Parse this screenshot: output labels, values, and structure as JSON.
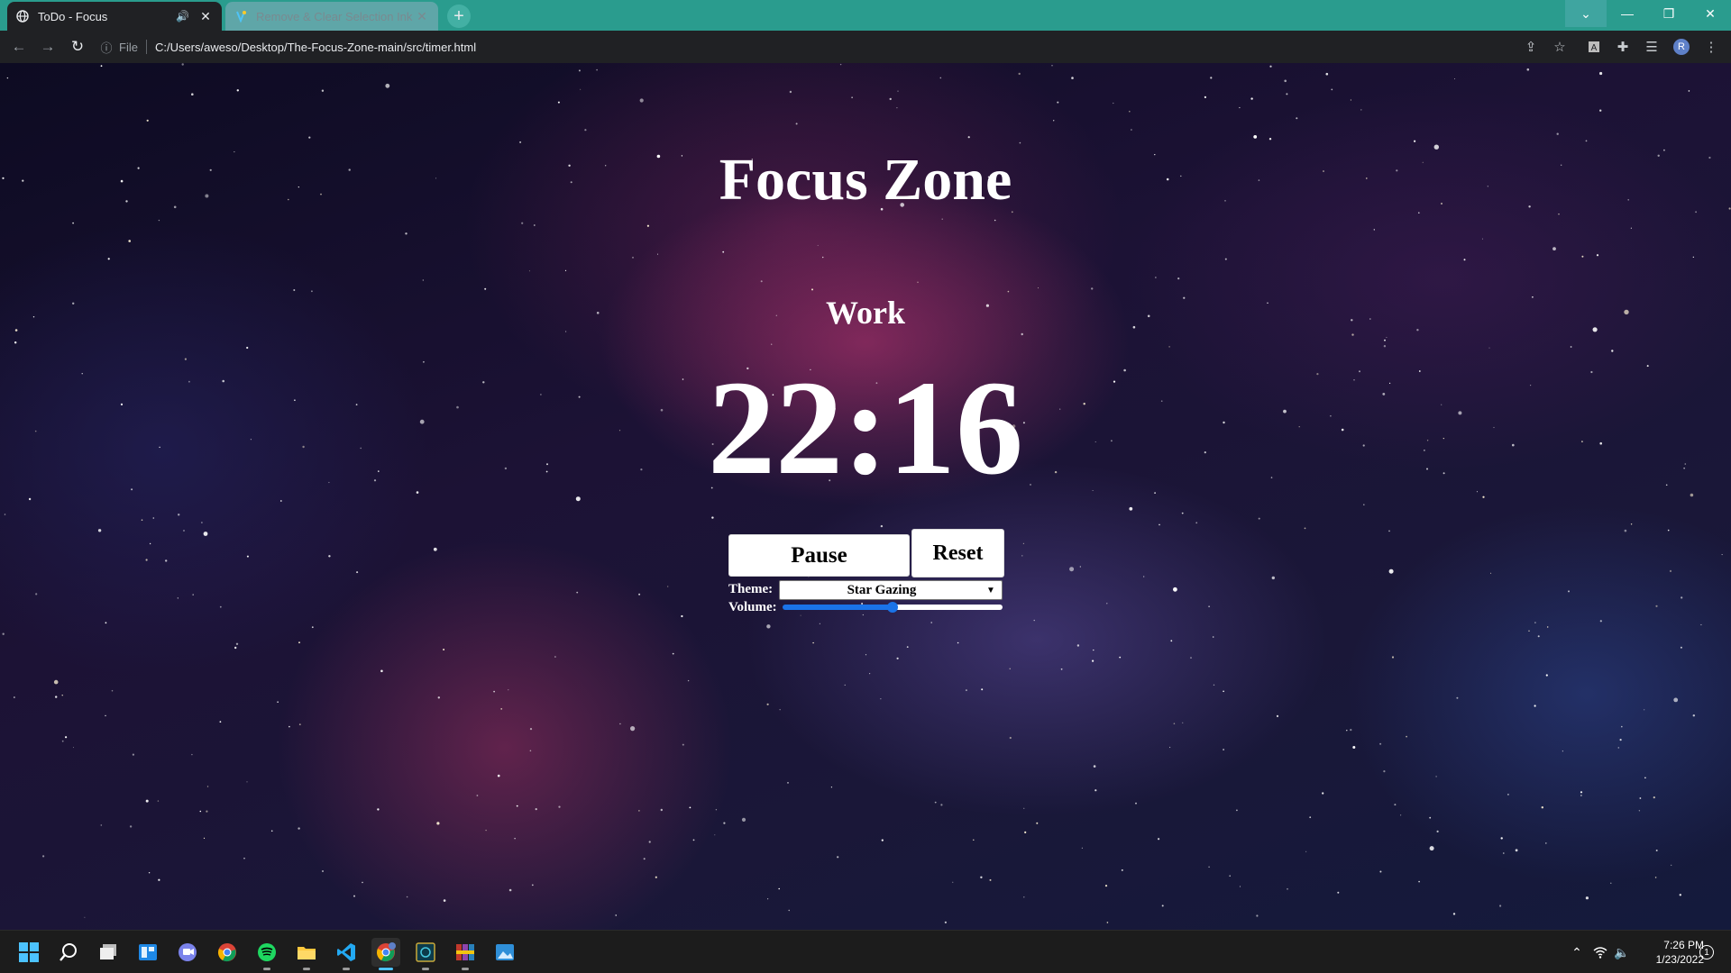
{
  "browser": {
    "tabs": [
      {
        "title": "ToDo - Focus",
        "active": true,
        "favicon": "globe-icon",
        "audio_icon": "speaker-icon"
      },
      {
        "title": "Remove & Clear Selection Ink Bo",
        "active": false,
        "favicon": "colorful-logo-icon"
      }
    ],
    "new_tab_label": "+",
    "address": {
      "info_icon": "info-icon",
      "scheme_label": "File",
      "url": "C:/Users/aweso/Desktop/The-Focus-Zone-main/src/timer.html"
    },
    "profile_initial": "R",
    "colors": {
      "tab_strip": "#2a9c8e",
      "toolbar": "#202124"
    }
  },
  "page": {
    "title": "Focus Zone",
    "mode": "Work",
    "timer": "22:16",
    "pause_label": "Pause",
    "reset_label": "Reset",
    "theme_label": "Theme:",
    "theme_value": "Star Gazing",
    "volume_label": "Volume:",
    "volume_fraction": 0.5,
    "colors": {
      "text": "#ffffff",
      "slider_accent": "#1a73e8"
    }
  },
  "taskbar": {
    "apps": [
      "windows-start-icon",
      "search-icon",
      "task-view-icon",
      "widgets-icon",
      "teams-chat-icon",
      "chrome-icon",
      "spotify-icon",
      "file-explorer-icon",
      "vscode-icon",
      "chrome-profile-icon",
      "game-icon",
      "winrar-icon",
      "photos-icon"
    ],
    "time": "7:26 PM",
    "date": "1/23/2022",
    "notification_count": "1"
  }
}
